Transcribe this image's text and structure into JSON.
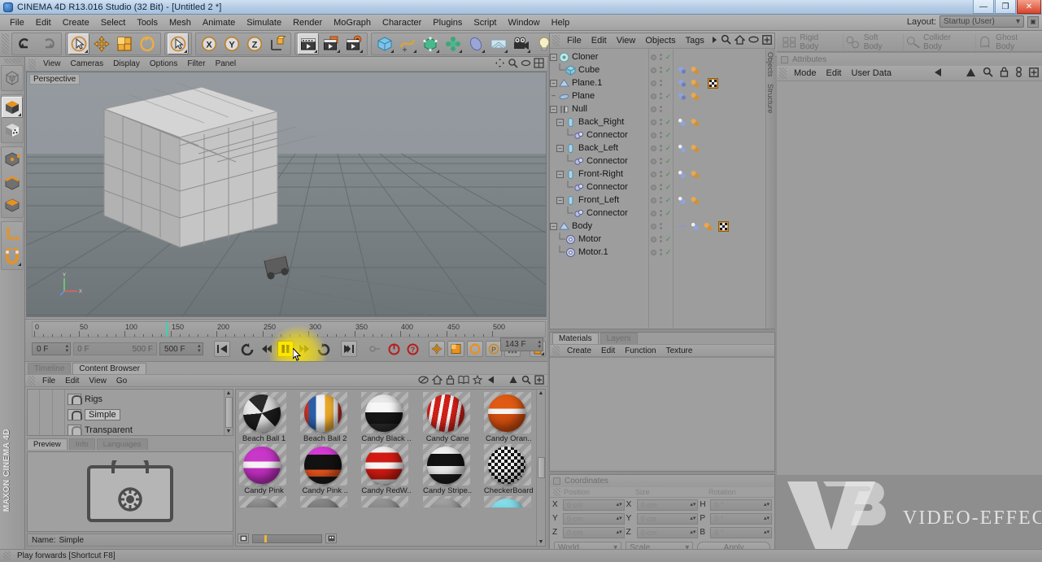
{
  "window": {
    "title": "CINEMA 4D R13.016 Studio (32 Bit) - [Untitled 2 *]",
    "app_icon": "c4d-app-icon",
    "minimize": "—",
    "maximize": "❐",
    "close": "✕"
  },
  "menubar": {
    "items": [
      "File",
      "Edit",
      "Create",
      "Select",
      "Tools",
      "Mesh",
      "Animate",
      "Simulate",
      "Render",
      "MoGraph",
      "Character",
      "Plugins",
      "Script",
      "Window",
      "Help"
    ],
    "layout_label": "Layout:",
    "layout_value": "Startup (User)"
  },
  "toolbar": {
    "groups": [
      {
        "name": "history",
        "buttons": [
          {
            "icon": "undo-icon",
            "label": "Undo",
            "active": false,
            "disabled": false
          },
          {
            "icon": "redo-icon",
            "label": "Redo",
            "active": false,
            "disabled": true
          }
        ]
      },
      {
        "name": "transform",
        "buttons": [
          {
            "icon": "live-selection-icon",
            "label": "Live Selection",
            "active": true
          },
          {
            "icon": "move-icon",
            "label": "Move"
          },
          {
            "icon": "scale-icon",
            "label": "Scale"
          },
          {
            "icon": "rotate-icon",
            "label": "Rotate"
          }
        ]
      },
      {
        "name": "select-mode",
        "buttons": [
          {
            "icon": "selection-mode-icon",
            "label": "Selection Mode",
            "active": true
          }
        ]
      },
      {
        "name": "axis-lock",
        "buttons": [
          {
            "icon": "axis-x-icon",
            "label": "X"
          },
          {
            "icon": "axis-y-icon",
            "label": "Y"
          },
          {
            "icon": "axis-z-icon",
            "label": "Z"
          },
          {
            "icon": "world-coord-icon",
            "label": "World/Object"
          }
        ]
      },
      {
        "name": "render",
        "buttons": [
          {
            "icon": "render-view-icon",
            "label": "Render View",
            "active": true
          },
          {
            "icon": "render-picture-viewer-icon",
            "label": "Render to Picture Viewer"
          },
          {
            "icon": "render-settings-icon",
            "label": "Edit Render Settings"
          }
        ]
      },
      {
        "name": "create",
        "buttons": [
          {
            "icon": "cube-primitive-icon",
            "label": "Add Cube Object"
          },
          {
            "icon": "spline-icon",
            "label": "Add Spline"
          },
          {
            "icon": "generator-icon",
            "label": "Add Generator"
          },
          {
            "icon": "deformer-icon",
            "label": "Add Deformer"
          },
          {
            "icon": "scene-object-icon",
            "label": "Scene Object"
          },
          {
            "icon": "environment-icon",
            "label": "Environment"
          },
          {
            "icon": "camera-icon",
            "label": "Camera"
          },
          {
            "icon": "light-icon",
            "label": "Light"
          }
        ]
      }
    ]
  },
  "left_toolbar": {
    "buttons": [
      {
        "icon": "make-editable-icon",
        "label": "Make Editable",
        "active": false
      },
      {
        "icon": "model-mode-icon",
        "label": "Model Mode",
        "active": true
      },
      {
        "icon": "texture-mode-icon",
        "label": "Texture Mode"
      },
      {
        "icon": "point-mode-icon",
        "label": "Point Mode"
      },
      {
        "icon": "edge-mode-icon",
        "label": "Edge Mode"
      },
      {
        "icon": "polygon-mode-icon",
        "label": "Polygon Mode"
      },
      {
        "icon": "axis-mode-icon",
        "label": "Enable Axis Modification"
      },
      {
        "icon": "snap-magnet-icon",
        "label": "Enable Snapping"
      }
    ],
    "brand": "MAXON CINEMA 4D"
  },
  "viewport": {
    "menu": [
      "View",
      "Cameras",
      "Display",
      "Options",
      "Filter",
      "Panel"
    ],
    "label": "Perspective",
    "axis_labels": {
      "x": "X",
      "y": "Y",
      "z": "Z"
    }
  },
  "timeline": {
    "tick_labels": [
      "0",
      "50",
      "100",
      "150",
      "200",
      "250",
      "300",
      "350",
      "400",
      "450",
      "500"
    ],
    "playhead_frame": 143,
    "current_frame_field": "0 F",
    "preview_range_start": "0 F",
    "preview_range_end": "500 F",
    "end_frame_field": "500 F",
    "frame_indicator": "143 F",
    "transport": [
      {
        "icon": "go-to-start-icon",
        "label": "Go to Start of Animation"
      },
      {
        "icon": "play-reverse-loop-icon",
        "label": "Play Backwards"
      },
      {
        "icon": "previous-frame-icon",
        "label": "Go to Previous Frame"
      },
      {
        "icon": "play-pause-icon",
        "label": "Play forwards",
        "active": true
      },
      {
        "icon": "next-frame-icon",
        "label": "Go to Next Frame"
      },
      {
        "icon": "loop-icon",
        "label": "Loop Preview Range"
      },
      {
        "icon": "go-to-end-icon",
        "label": "Go to End of Animation"
      },
      {
        "icon": "autokey-icon",
        "label": "Autokeying",
        "disabled": true
      },
      {
        "icon": "record-icon",
        "label": "Record Active Objects"
      },
      {
        "icon": "keyframe-help-icon",
        "label": "Keyframe Selection"
      }
    ],
    "record_toggles": [
      {
        "icon": "position-key-icon",
        "label": "Record Position"
      },
      {
        "icon": "scale-key-icon",
        "label": "Record Scale"
      },
      {
        "icon": "rotation-key-icon",
        "label": "Record Rotation"
      },
      {
        "icon": "pla-key-icon",
        "label": "Record Point Level Animation"
      },
      {
        "icon": "parameter-key-icon",
        "label": "Record Parameter"
      }
    ],
    "extra_button": {
      "icon": "timeline-keymode-icon",
      "label": "Key Mode"
    },
    "tooltip": "Play forwards [Shortcut F8]"
  },
  "content_browser": {
    "tabs": [
      {
        "label": "Timeline",
        "active": false
      },
      {
        "label": "Content Browser",
        "active": true
      }
    ],
    "menu": [
      "File",
      "Edit",
      "View",
      "Go"
    ],
    "tree": [
      {
        "label": "Rigs",
        "selected": false,
        "locked": true
      },
      {
        "label": "Simple",
        "selected": true,
        "locked": true
      },
      {
        "label": "Transparent",
        "selected": false,
        "locked": false
      }
    ],
    "preview_tabs": [
      {
        "label": "Preview",
        "active": true
      },
      {
        "label": "Info",
        "active": false
      },
      {
        "label": "Languages",
        "active": false
      }
    ],
    "preview_icon": "locked-folder-preview-icon",
    "name_label": "Name:",
    "name_value": "Simple",
    "materials": [
      {
        "label": "Beach Ball 1",
        "style": "beachball1"
      },
      {
        "label": "Beach Ball 2",
        "style": "beachball2"
      },
      {
        "label": "Candy Black ..",
        "style": "candyblack"
      },
      {
        "label": "Candy Cane",
        "style": "candycane"
      },
      {
        "label": "Candy Oran..",
        "style": "candyorange"
      },
      {
        "label": "Candy Pink",
        "style": "candypink"
      },
      {
        "label": "Candy Pink ..",
        "style": "candypinkblack"
      },
      {
        "label": "Candy RedW..",
        "style": "candyredwhite"
      },
      {
        "label": "Candy Stripe..",
        "style": "candystripe"
      },
      {
        "label": "CheckerBoard",
        "style": "checkerboard"
      }
    ],
    "footer_icon": "thumbnail-size-icon",
    "footer_icon2": "view-mode-icon"
  },
  "object_manager": {
    "menu": [
      "File",
      "Edit",
      "View",
      "Objects",
      "Tags"
    ],
    "icons": [
      "search-icon",
      "home-icon",
      "ellipse-icon",
      "fullscreen-icon"
    ],
    "side_tabs": [
      "Objects",
      "Structure"
    ],
    "rows": [
      {
        "label": "Cloner",
        "depth": 0,
        "expander": "-",
        "icon": "cloner-icon",
        "visible_dots": true,
        "check": true,
        "tags": []
      },
      {
        "label": "Cube",
        "depth": 1,
        "expander": "",
        "icon": "cube-icon",
        "visible_dots": true,
        "check": true,
        "tags": [
          "dynamics-tag",
          "phong-tag",
          "material-tag"
        ]
      },
      {
        "label": "Plane.1",
        "depth": 0,
        "expander": "-",
        "icon": "plane-icon",
        "visible_dots": true,
        "check": false,
        "tags": [
          "dynamics-tag",
          "phong-tag",
          "material-tag",
          "texture-tag"
        ]
      },
      {
        "label": "Plane",
        "depth": 0,
        "expander": "-",
        "icon": "plane-icon",
        "visible_dots": true,
        "check": true,
        "tags": [
          "dynamics-tag",
          "phong-tag",
          "material-tag"
        ]
      },
      {
        "label": "Null",
        "depth": 0,
        "expander": "-",
        "icon": "null-icon",
        "visible_dots": true,
        "check": false,
        "tags": []
      },
      {
        "label": "Back_Right",
        "depth": 1,
        "expander": "-",
        "icon": "capsule-icon",
        "visible_dots": true,
        "check": true,
        "tags": [
          "dynamics-tag",
          "phong-tag",
          "material-tag"
        ]
      },
      {
        "label": "Connector",
        "depth": 2,
        "expander": "",
        "icon": "connector-icon",
        "visible_dots": true,
        "check": true,
        "tags": []
      },
      {
        "label": "Back_Left",
        "depth": 1,
        "expander": "-",
        "icon": "capsule-icon",
        "visible_dots": true,
        "check": true,
        "tags": [
          "dynamics-tag",
          "phong-tag",
          "material-tag"
        ]
      },
      {
        "label": "Connector",
        "depth": 2,
        "expander": "",
        "icon": "connector-icon",
        "visible_dots": true,
        "check": true,
        "tags": []
      },
      {
        "label": "Front-Right",
        "depth": 1,
        "expander": "-",
        "icon": "capsule-icon",
        "visible_dots": true,
        "check": true,
        "tags": [
          "dynamics-tag",
          "phong-tag",
          "material-tag"
        ]
      },
      {
        "label": "Connector",
        "depth": 2,
        "expander": "",
        "icon": "connector-icon",
        "visible_dots": true,
        "check": true,
        "tags": []
      },
      {
        "label": "Front_Left",
        "depth": 1,
        "expander": "-",
        "icon": "capsule-icon",
        "visible_dots": true,
        "check": true,
        "tags": [
          "dynamics-tag",
          "phong-tag",
          "material-tag"
        ]
      },
      {
        "label": "Connector",
        "depth": 2,
        "expander": "",
        "icon": "connector-icon",
        "visible_dots": true,
        "check": true,
        "tags": []
      },
      {
        "label": "Body",
        "depth": 0,
        "expander": "-",
        "icon": "plane-icon",
        "visible_dots": true,
        "check": false,
        "tags": [
          "deform-tag",
          "dynamics-tag",
          "phong-tag",
          "material-tag",
          "texture-tag"
        ]
      },
      {
        "label": "Motor",
        "depth": 1,
        "expander": "",
        "icon": "motor-icon",
        "visible_dots": true,
        "check": true,
        "tags": []
      },
      {
        "label": "Motor.1",
        "depth": 1,
        "expander": "",
        "icon": "motor-icon",
        "visible_dots": true,
        "check": true,
        "tags": []
      }
    ]
  },
  "materials_panel": {
    "tabs": [
      {
        "label": "Materials",
        "active": true
      },
      {
        "label": "Layers",
        "active": false
      }
    ],
    "menu": [
      "Create",
      "Edit",
      "Function",
      "Texture"
    ]
  },
  "dynamics_bar": {
    "buttons": [
      {
        "label": "Rigid Body",
        "icon": "rigid-body-icon"
      },
      {
        "label": "Soft Body",
        "icon": "soft-body-icon"
      },
      {
        "label": "Collider Body",
        "icon": "collider-body-icon"
      },
      {
        "label": "Ghost Body",
        "icon": "ghost-body-icon"
      }
    ]
  },
  "attributes": {
    "title": "Attributes",
    "menu": [
      "Mode",
      "Edit",
      "User Data"
    ],
    "icons": [
      "back-arrow-icon",
      "up-arrow-icon",
      "search-icon",
      "lock-icon",
      "link-icon",
      "fullscreen-icon"
    ]
  },
  "coordinates": {
    "title": "Coordinates",
    "headers": [
      "Position",
      "Size",
      "Rotation"
    ],
    "rows": [
      {
        "pos_label": "X",
        "pos_value": "0 cm",
        "size_label": "X",
        "size_value": "0 cm",
        "rot_label": "H",
        "rot_value": "0 °"
      },
      {
        "pos_label": "Y",
        "pos_value": "0 cm",
        "size_label": "Y",
        "size_value": "0 cm",
        "rot_label": "P",
        "rot_value": "0 °"
      },
      {
        "pos_label": "Z",
        "pos_value": "0 cm",
        "size_label": "Z",
        "size_value": "0 cm",
        "rot_label": "B",
        "rot_value": "0 °"
      }
    ],
    "system": "World",
    "mode": "Scale",
    "apply": "Apply"
  },
  "watermark": {
    "logo": "VE",
    "text": "VIDEO-EFFECTS.IR"
  },
  "statusbar": {
    "message": "Play forwards [Shortcut F8]"
  },
  "colors": {
    "chrome": "#9a9a9a",
    "accent_orange": "#e8921f",
    "highlight_yellow": "#ffe400",
    "title_blue": "#b4cbe4",
    "check_green": "#3e8f49"
  }
}
